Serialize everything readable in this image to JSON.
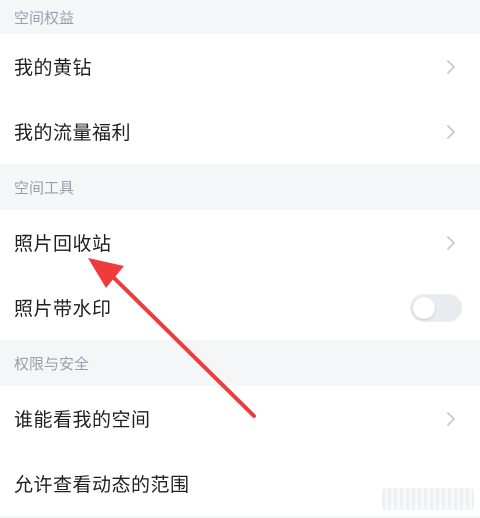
{
  "sections": {
    "rights": {
      "header": "空间权益",
      "items": [
        {
          "label": "我的黄钻"
        },
        {
          "label": "我的流量福利"
        }
      ]
    },
    "tools": {
      "header": "空间工具",
      "items": [
        {
          "label": "照片回收站"
        },
        {
          "label": "照片带水印",
          "toggle": false
        }
      ]
    },
    "privacy": {
      "header": "权限与安全",
      "items": [
        {
          "label": "谁能看我的空间"
        },
        {
          "label": "允许查看动态的范围"
        }
      ]
    }
  },
  "colors": {
    "background": "#f5f6f8",
    "row_background": "#ffffff",
    "header_text": "#9b9ea6",
    "primary_text": "#1f1f1f",
    "chevron": "#c6c8cc",
    "toggle_off": "#e9ebef",
    "annotation_arrow": "#ee3b3b"
  },
  "icons": {
    "chevron": "chevron-right-icon"
  }
}
